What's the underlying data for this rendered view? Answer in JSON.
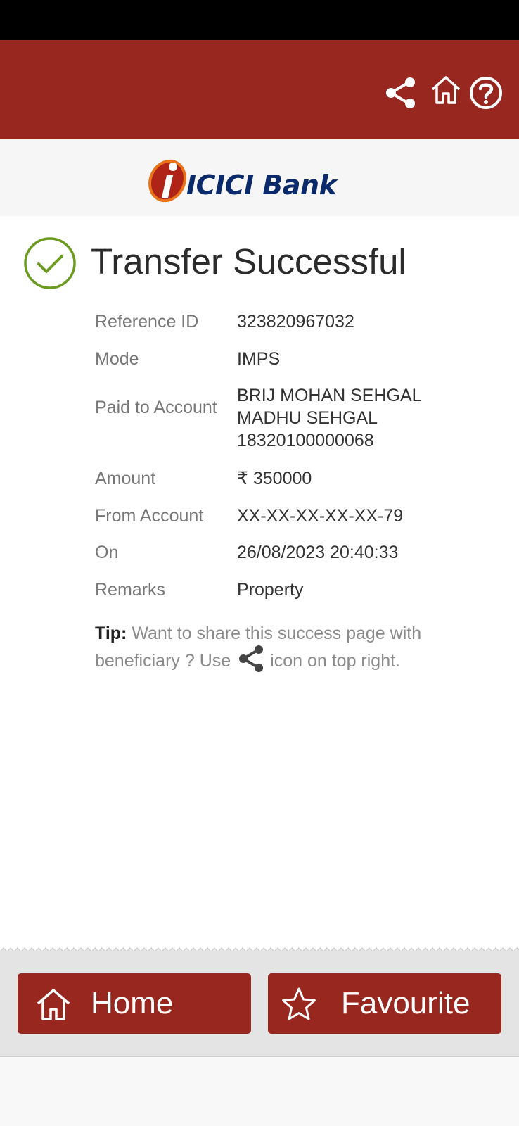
{
  "header": {
    "icons": [
      "share-icon",
      "home-icon",
      "help-icon"
    ],
    "brand_color": "#97271f"
  },
  "logo": {
    "text": "ICICI Bank"
  },
  "status": {
    "title": "Transfer Successful",
    "icon": "check-circle-icon",
    "accent_color": "#6a9a1f"
  },
  "details": [
    {
      "label": "Reference ID",
      "value": "323820967032"
    },
    {
      "label": "Mode",
      "value": "IMPS"
    },
    {
      "label": "Paid to Account",
      "value_lines": [
        "BRIJ MOHAN SEHGAL",
        "MADHU SEHGAL",
        "18320100000068"
      ]
    },
    {
      "label": "Amount",
      "value": "₹ 350000"
    },
    {
      "label": "From Account",
      "value": "XX-XX-XX-XX-XX-79"
    },
    {
      "label": "On",
      "value": "26/08/2023 20:40:33"
    },
    {
      "label": "Remarks",
      "value": "Property"
    }
  ],
  "tip": {
    "label": "Tip:",
    "text_before": "Want to share this success page with beneficiary ? Use",
    "icon": "share-icon",
    "text_after": "icon on top right."
  },
  "footer": {
    "home_label": "Home",
    "favourite_label": "Favourite"
  }
}
